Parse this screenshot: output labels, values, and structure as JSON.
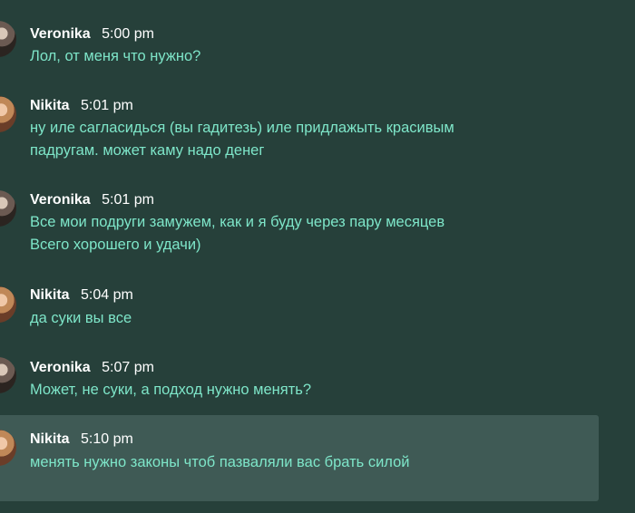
{
  "messages": [
    {
      "author": "Veronika",
      "time": "5:00 pm",
      "lines": [
        "Лол, от меня что нужно?"
      ]
    },
    {
      "author": "Nikita",
      "time": "5:01 pm",
      "lines": [
        "ну иле сагласидься (вы гадитезь) иле придлажыть красивым",
        "падругам. может каму надо денег"
      ]
    },
    {
      "author": "Veronika",
      "time": "5:01 pm",
      "lines": [
        "Все мои подруги замужем, как и я буду через пару месяцев",
        "Всего хорошего и удачи)"
      ]
    },
    {
      "author": "Nikita",
      "time": "5:04 pm",
      "lines": [
        "да суки вы все"
      ]
    },
    {
      "author": "Veronika",
      "time": "5:07 pm",
      "lines": [
        "Может, не суки, а подход нужно менять?"
      ]
    },
    {
      "author": "Nikita",
      "time": "5:10 pm",
      "lines": [
        "менять нужно законы чтоб пазваляли вас брать силой"
      ]
    }
  ],
  "colors": {
    "background": "#26403a",
    "highlight": "#3f5a55",
    "name": "#ffffff",
    "message_text": "#7ee6c9"
  }
}
